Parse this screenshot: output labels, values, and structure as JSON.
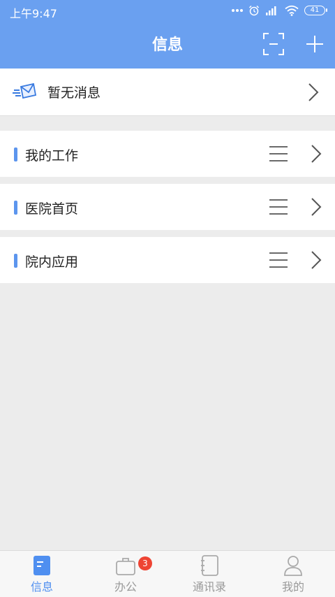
{
  "status_bar": {
    "time": "上午9:47",
    "battery": "41"
  },
  "header": {
    "title": "信息"
  },
  "message_row": {
    "label": "暂无消息"
  },
  "sections": [
    {
      "label": "我的工作"
    },
    {
      "label": "医院首页"
    },
    {
      "label": "院内应用"
    }
  ],
  "tabbar": {
    "items": [
      {
        "label": "信息",
        "active": true
      },
      {
        "label": "办公",
        "badge": "3"
      },
      {
        "label": "通讯录"
      },
      {
        "label": "我的"
      }
    ]
  },
  "colors": {
    "header_bg": "#6aa0f0",
    "accent": "#5c95ee",
    "badge": "#ee4433"
  }
}
